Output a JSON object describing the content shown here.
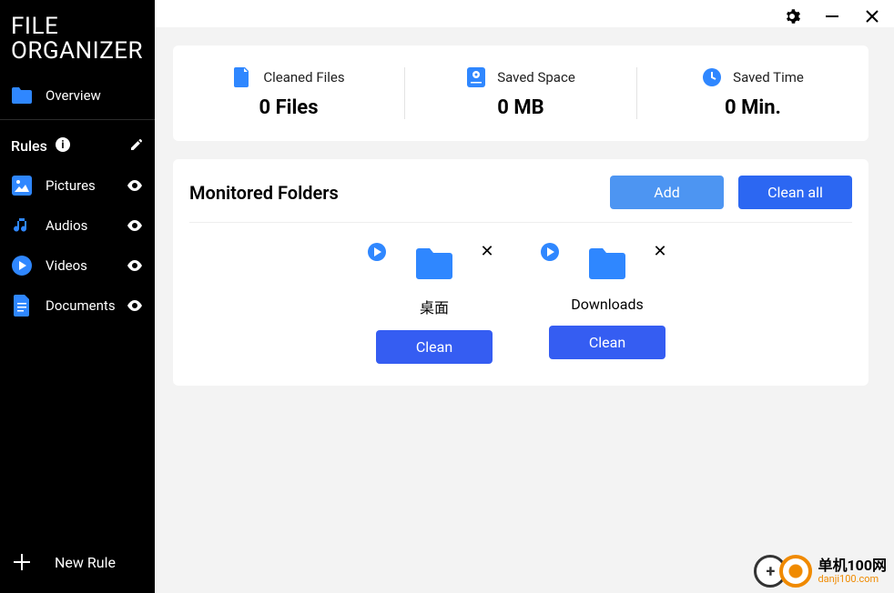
{
  "app": {
    "title_line1": "FILE",
    "title_line2": "ORGANIZER"
  },
  "sidebar": {
    "overview": "Overview",
    "rules_label": "Rules",
    "rules": [
      {
        "label": "Pictures"
      },
      {
        "label": "Audios"
      },
      {
        "label": "Videos"
      },
      {
        "label": "Documents"
      }
    ],
    "new_rule": "New Rule"
  },
  "topbar": {},
  "stats": [
    {
      "label": "Cleaned Files",
      "value": "0 Files"
    },
    {
      "label": "Saved Space",
      "value": "0 MB"
    },
    {
      "label": "Saved Time",
      "value": "0 Min."
    }
  ],
  "panel": {
    "title": "Monitored Folders",
    "add": "Add",
    "clean_all": "Clean all"
  },
  "folders": [
    {
      "name": "桌面",
      "clean": "Clean"
    },
    {
      "name": "Downloads",
      "clean": "Clean"
    }
  ],
  "watermark": {
    "line1": "单机100网",
    "line2": "danji100.com"
  },
  "colors": {
    "accent1": "#2c67f2",
    "accent2": "#4d95f2",
    "accent3": "#355df2",
    "folder": "#2f87ff"
  }
}
